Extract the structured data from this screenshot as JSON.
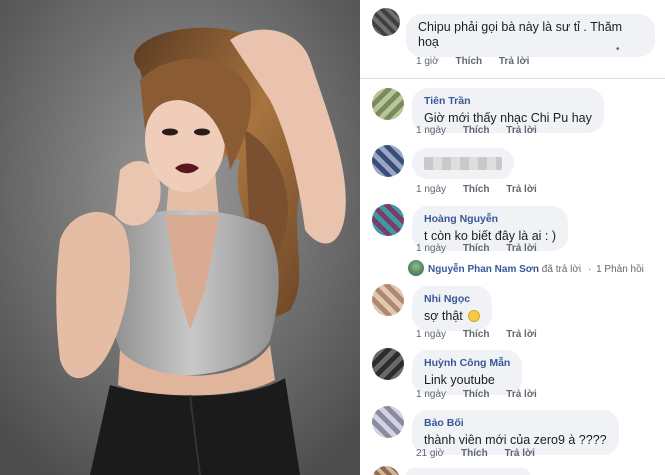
{
  "comments": [
    {
      "name": "",
      "text": "Chipu phải gọi bà này là sư tỉ . Thăm",
      "text2": "hoạ",
      "time": "1 giờ",
      "like": "Thích",
      "reply": "Trả lời",
      "menu": "•",
      "menu_icon": "ellipsis-icon"
    },
    {
      "name": "Tiên Trần",
      "text": "Giờ mới thấy nhạc Chi Pu hay",
      "time": "1 ngày",
      "like": "Thích",
      "reply": "Trả lời"
    },
    {
      "name": "",
      "text": "",
      "time": "1 ngày",
      "like": "Thích",
      "reply": "Trả lời"
    },
    {
      "name": "Hoàng Nguyễn",
      "text": "t còn ko biết đây là ai : )",
      "time": "1 ngày",
      "like": "Thích",
      "reply": "Trả lời",
      "reply_by": "Nguyễn Phan Nam Sơn",
      "reply_action": "đã trả lời",
      "reply_count": "1 Phản hồi",
      "reply_icon": "reply-arrow-icon"
    },
    {
      "name": "Nhi Ngọc",
      "text": "sợ thật",
      "emoji": "slightly-smiling-emoji",
      "time": "1 ngày",
      "like": "Thích",
      "reply": "Trả lời"
    },
    {
      "name": "Huỳnh Công Mẫn",
      "text": "Link youtube",
      "time": "1 ngày",
      "like": "Thích",
      "reply": "Trả lời"
    },
    {
      "name": "Bảo Bối",
      "text": "thành viên mới của zero9 à ????",
      "time": "21 giờ",
      "like": "Thích",
      "reply": "Trả lời"
    }
  ],
  "colors": {
    "bubble": "#f0f2f5",
    "name": "#365899",
    "meta": "#606770"
  }
}
